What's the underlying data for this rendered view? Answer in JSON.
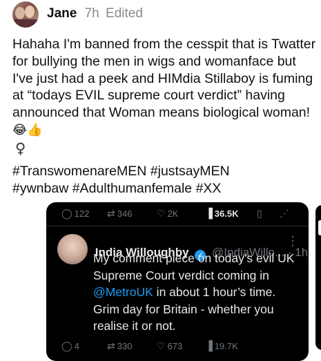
{
  "post": {
    "author": "Jane",
    "time": "7h",
    "edited": "Edited",
    "text_part1": "Hahaha I'm banned from the cesspit that is Twatter for bullying the men in wigs and womanface but I've just had a peek and HIMdia Stillaboy is fuming at “todays EVIL supreme court verdict” having announced that Woman means biological woman!",
    "emoji": "😂👍",
    "venus_symbol": "♀",
    "hashtags_line1": "#TranswomenareMEN #justsayMEN",
    "hashtags_line2": "#ywnbaw #Adulthumanfemale #XX"
  },
  "embed": {
    "actions": {
      "replies": "122",
      "reposts": "346",
      "likes": "2K",
      "views": "36.5K"
    },
    "author_name": "India Willoughby",
    "handle": "@IndiaWillo...",
    "time": "· 1h",
    "more": "⋮",
    "text_before": "My comment piece on today’s evil UK Supreme Court verdict coming in ",
    "mention": "@MetroUK",
    "text_after": " in about 1 hour’s time. Grim day for Britain - whether you realise it or not.",
    "bottom_actions": {
      "replies": "4",
      "reposts": "330",
      "likes": "673",
      "views": "19.7K"
    }
  },
  "colors": {
    "embed_bg": "#000000",
    "mention": "#1d9bf0",
    "verified": "#1d9bf0",
    "muted": "#71767b"
  },
  "icons": [
    "reply-icon",
    "repost-icon",
    "like-icon",
    "views-icon",
    "bookmark-icon",
    "share-icon",
    "verified-badge-icon",
    "more-icon"
  ]
}
